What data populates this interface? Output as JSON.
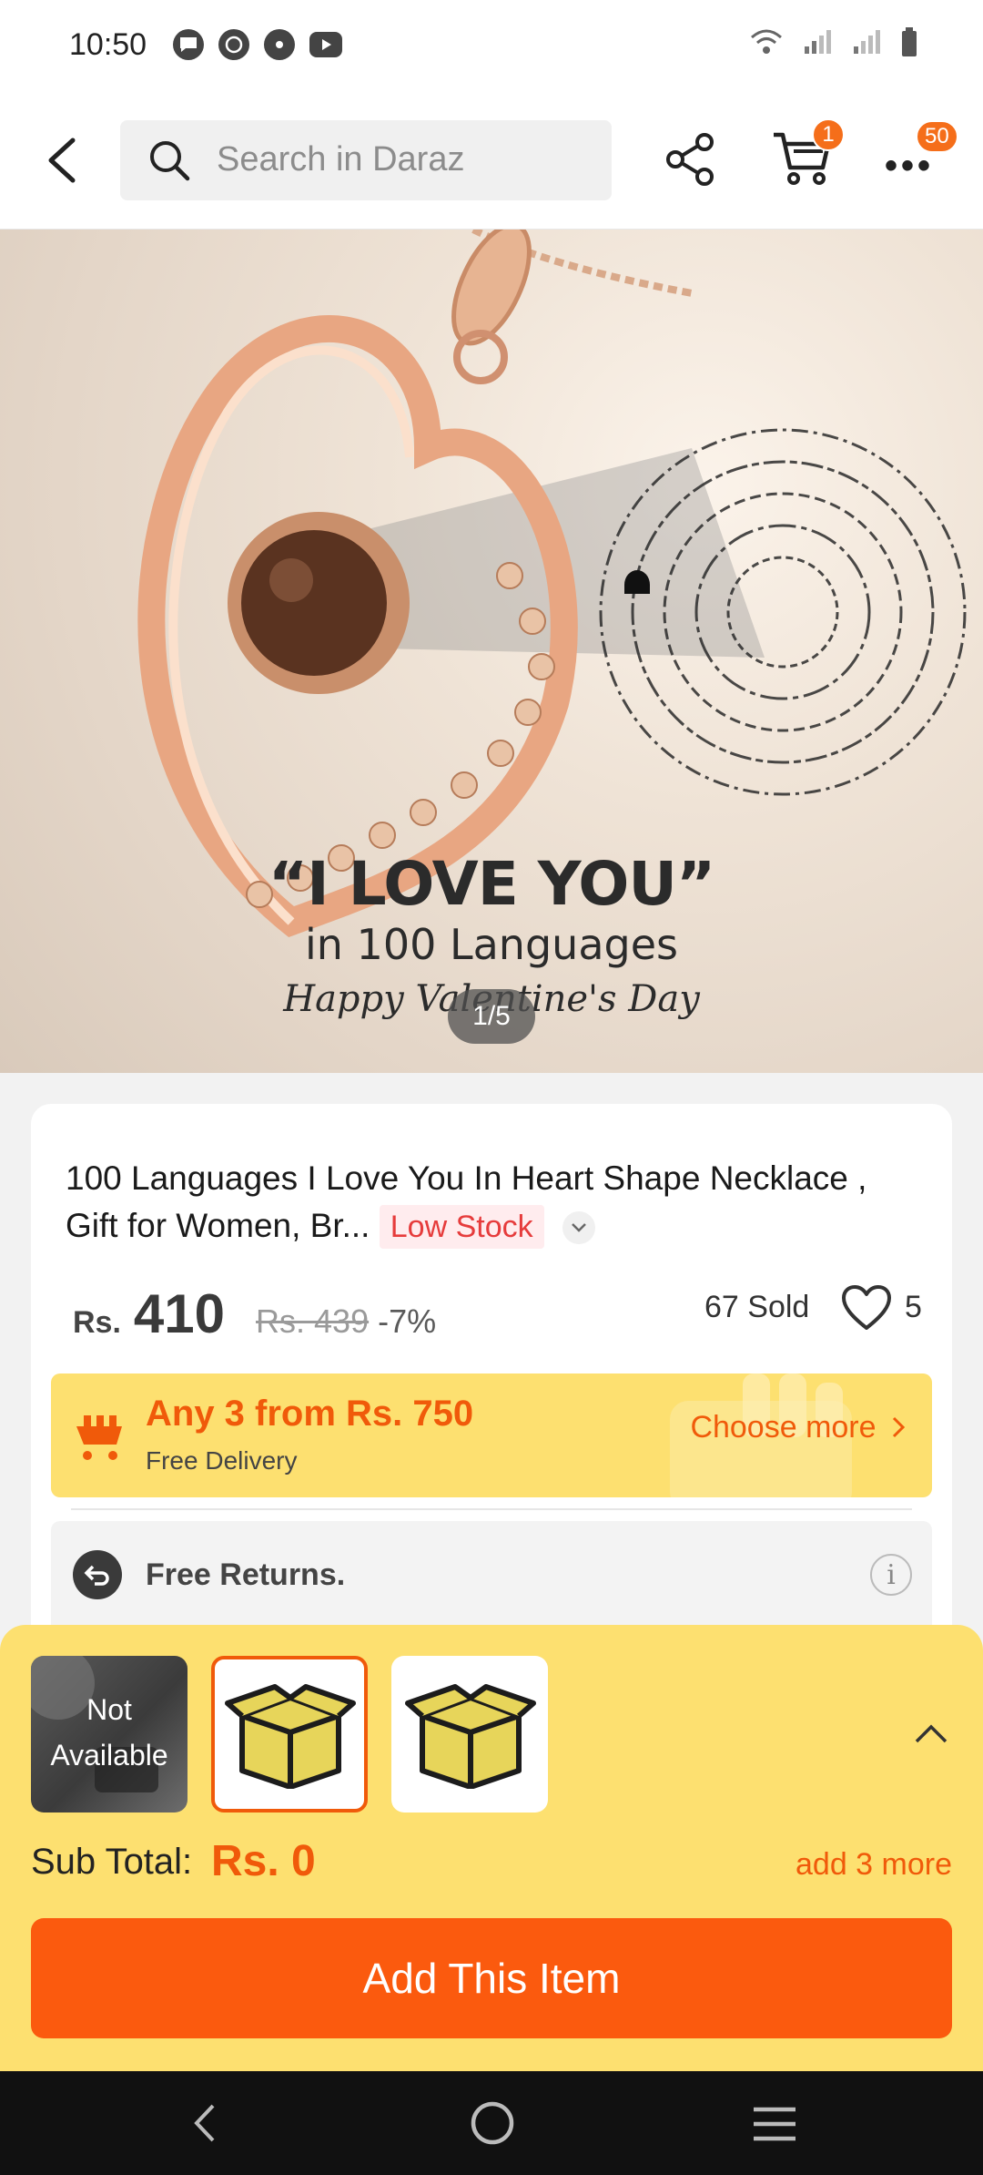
{
  "status_bar": {
    "time": "10:50",
    "notification_icons": [
      "chat-icon",
      "whatsapp-icon",
      "chrome-icon",
      "youtube-icon"
    ],
    "system_icons": [
      "wifi-icon",
      "signal-icon",
      "signal-icon",
      "battery-icon"
    ]
  },
  "header": {
    "search_placeholder": "Search in Daraz",
    "cart_badge": "1",
    "more_badge": "50"
  },
  "gallery": {
    "counter": "1/5",
    "image_text_line1": "“I LOVE YOU”",
    "image_text_line2": "in 100 Languages",
    "image_text_line3": "Happy Valentine's Day"
  },
  "product": {
    "title": "100 Languages I Love You In Heart Shape Necklace , Gift for Women, Br...",
    "stock_label": "Low Stock",
    "currency": "Rs.",
    "price": "410",
    "original_price": "Rs. 439",
    "discount": "-7%",
    "sold": "67 Sold",
    "likes": "5"
  },
  "promo": {
    "title": "Any 3 from Rs. 750",
    "subtitle": "Free Delivery",
    "cta": "Choose more"
  },
  "returns": {
    "label": "Free Returns."
  },
  "bundle_sheet": {
    "items": [
      {
        "label": "Not Available",
        "state": "unavailable"
      },
      {
        "label": "",
        "state": "selected"
      },
      {
        "label": "",
        "state": "default"
      }
    ],
    "subtotal_label": "Sub Total:",
    "subtotal_value": "Rs. 0",
    "add_more": "add 3 more",
    "button": "Add This Item"
  },
  "colors": {
    "accent": "#f05a0a",
    "promo_bg": "#fde070",
    "button_bg": "#fb5a0e"
  }
}
